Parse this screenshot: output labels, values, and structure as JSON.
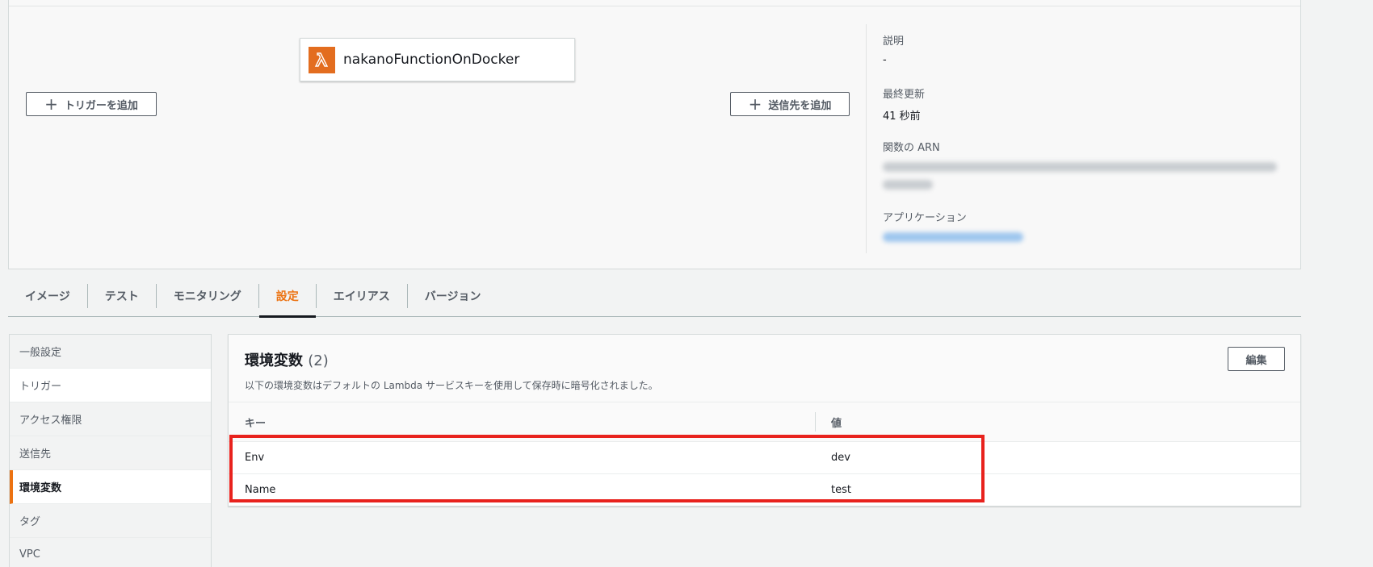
{
  "function": {
    "name": "nakanoFunctionOnDocker",
    "icon": "lambda-icon"
  },
  "buttons": {
    "add_trigger": "トリガーを追加",
    "add_destination": "送信先を追加",
    "edit": "編集"
  },
  "meta": {
    "description_label": "説明",
    "description_value": "-",
    "last_modified_label": "最終更新",
    "last_modified_value": "41 秒前",
    "arn_label": "関数の ARN",
    "application_label": "アプリケーション"
  },
  "tabs": [
    {
      "label": "イメージ"
    },
    {
      "label": "テスト"
    },
    {
      "label": "モニタリング"
    },
    {
      "label": "設定",
      "active": true
    },
    {
      "label": "エイリアス"
    },
    {
      "label": "バージョン"
    }
  ],
  "sidenav": [
    {
      "label": "一般設定"
    },
    {
      "label": "トリガー"
    },
    {
      "label": "アクセス権限"
    },
    {
      "label": "送信先"
    },
    {
      "label": "環境変数",
      "active": true
    },
    {
      "label": "タグ"
    },
    {
      "label": "VPC"
    }
  ],
  "env": {
    "title": "環境変数",
    "count": "(2)",
    "description": "以下の環境変数はデフォルトの Lambda サービスキーを使用して保存時に暗号化されました。",
    "col_key": "キー",
    "col_value": "値",
    "rows": [
      {
        "key": "Env",
        "value": "dev"
      },
      {
        "key": "Name",
        "value": "test"
      }
    ]
  },
  "colors": {
    "accent": "#ec7211",
    "highlight": "#e8221d"
  }
}
